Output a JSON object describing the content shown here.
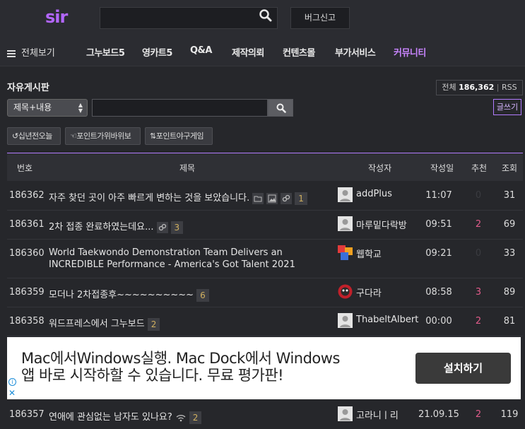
{
  "header": {
    "logo": "sir",
    "search_placeholder": "",
    "bug_report": "버그신고"
  },
  "nav": {
    "all_menu": "전체보기",
    "items": [
      "그누보드5",
      "영카트5",
      "Q&A",
      "제작의뢰",
      "컨텐츠몰",
      "부가서비스",
      "커뮤니티"
    ],
    "active_index": 6
  },
  "board": {
    "title": "자유게시판",
    "total_label": "전체",
    "total_count": "186,362",
    "rss": "RSS",
    "write": "글쓰기",
    "search_select": "제목+내용",
    "filters": [
      "십년전오늘",
      "포인트가위바위보",
      "포인트야구게임"
    ]
  },
  "table": {
    "headers": [
      "번호",
      "제목",
      "작성자",
      "작성일",
      "추천",
      "조회"
    ],
    "rows": [
      {
        "no": "186362",
        "title": "자주 찾던 곳이 아주 빠르게 변하는 것을 보았습니다.",
        "icons": [
          "folder-icon",
          "image-icon",
          "link-icon"
        ],
        "comments": "1",
        "author": "addPlus",
        "date": "11:07",
        "rec": "0",
        "views": "31"
      },
      {
        "no": "186361",
        "title": "2차 접종 완료하였는데요...",
        "icons": [
          "link-icon"
        ],
        "comments": "3",
        "author": "마루밑다락방",
        "date": "09:51",
        "rec": "2",
        "views": "69"
      },
      {
        "no": "186360",
        "title": "World Taekwondo Demonstration Team Delivers an INCREDIBLE Performance - America's Got Talent 2021",
        "icons": [],
        "comments": "",
        "author": "웹학교",
        "date": "09:21",
        "rec": "0",
        "views": "33"
      },
      {
        "no": "186359",
        "title": "모더나 2차접종후~~~~~~~~~~",
        "icons": [],
        "comments": "6",
        "author": "구다라",
        "date": "08:58",
        "rec": "3",
        "views": "89"
      },
      {
        "no": "186358",
        "title": "워드프레스에서 그누보드",
        "icons": [],
        "comments": "2",
        "author": "ThabeltAlbert",
        "date": "00:00",
        "rec": "2",
        "views": "81"
      },
      {
        "no": "186357",
        "title": "연애에 관심없는 남자도 있나요?",
        "icons": [
          "wifi-icon"
        ],
        "comments": "2",
        "author": "고라니ㅣ리",
        "date": "21.09.15",
        "rec": "2",
        "views": "119"
      }
    ]
  },
  "ad": {
    "line1": "Mac에서Windows실행. Mac Dock에서 Windows",
    "line2": "앱 바로 시작하할 수 있습니다. 무료 평가판!",
    "button": "설치하기"
  },
  "colors": {
    "accent": "#b27cff",
    "logo": "#b366ff",
    "recommend": "#e05b8a",
    "comment": "#d0b060"
  }
}
